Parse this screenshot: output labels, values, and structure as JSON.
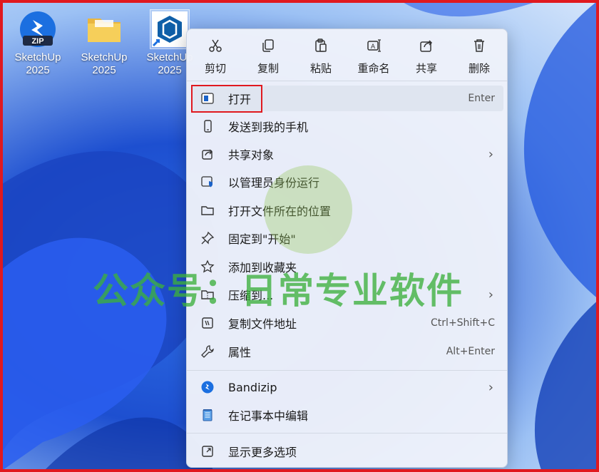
{
  "desktop": {
    "icons": [
      {
        "name": "SketchUp",
        "line2": "2025",
        "badge": "ZIP"
      },
      {
        "name": "SketchUp",
        "line2": "2025"
      },
      {
        "name": "SketchUp",
        "line2": "2025"
      }
    ]
  },
  "toolbar": {
    "cut": "剪切",
    "copy": "复制",
    "paste": "粘贴",
    "rename": "重命名",
    "share": "共享",
    "delete": "删除"
  },
  "menu": {
    "open": {
      "label": "打开",
      "shortcut": "Enter"
    },
    "send_phone": {
      "label": "发送到我的手机"
    },
    "share_with": {
      "label": "共享对象"
    },
    "run_admin": {
      "label": "以管理员身份运行"
    },
    "open_location": {
      "label": "打开文件所在的位置"
    },
    "pin_start": {
      "label": "固定到\"开始\""
    },
    "add_favorites": {
      "label": "添加到收藏夹"
    },
    "compress": {
      "label": "压缩到..."
    },
    "copy_path": {
      "label": "复制文件地址",
      "shortcut": "Ctrl+Shift+C"
    },
    "properties": {
      "label": "属性",
      "shortcut": "Alt+Enter"
    },
    "bandizip": {
      "label": "Bandizip"
    },
    "notepad": {
      "label": "在记事本中编辑"
    },
    "more": {
      "label": "显示更多选项"
    }
  },
  "watermark": "公众号：日常专业软件",
  "colors": {
    "highlight_border": "#e0191f",
    "watermark": "#3caf3c",
    "accent": "#1d4fd0"
  }
}
